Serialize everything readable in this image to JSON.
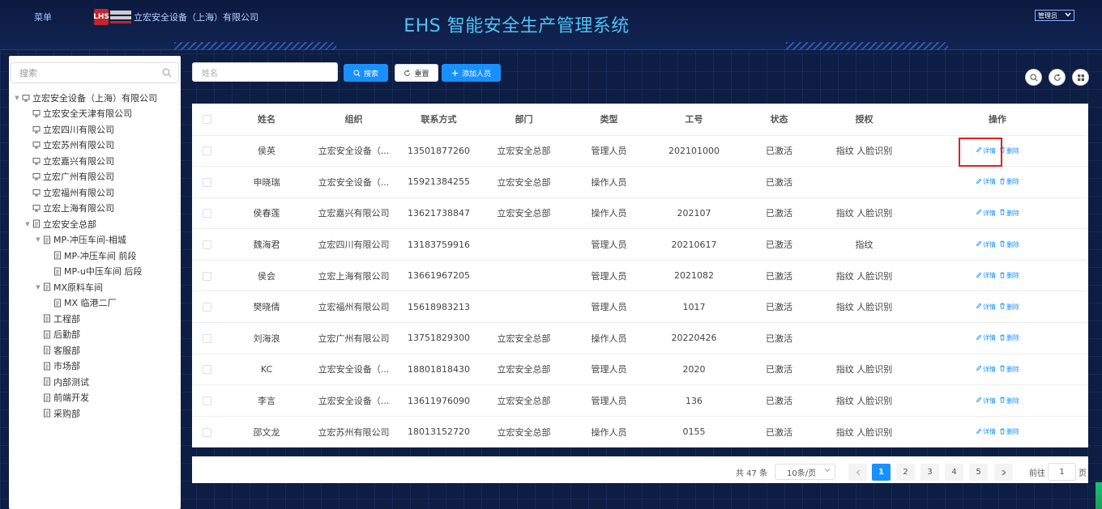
{
  "header": {
    "menu_label": "菜单",
    "logo_mark": "LHS",
    "company": "立宏安全设备（上海）有限公司",
    "title": "EHS 智能安全生产管理系统",
    "user_select": "管理员"
  },
  "sidebar": {
    "search_placeholder": "搜索",
    "nodes": [
      {
        "label": "立宏安全设备（上海）有限公司",
        "level": 0,
        "arrow": "▼",
        "icon": "monitor-icon"
      },
      {
        "label": "立宏安全天津有限公司",
        "level": 1,
        "arrow": "",
        "icon": "monitor-icon"
      },
      {
        "label": "立宏四川有限公司",
        "level": 1,
        "arrow": "",
        "icon": "monitor-icon"
      },
      {
        "label": "立宏苏州有限公司",
        "level": 1,
        "arrow": "",
        "icon": "monitor-icon"
      },
      {
        "label": "立宏嘉兴有限公司",
        "level": 1,
        "arrow": "",
        "icon": "monitor-icon"
      },
      {
        "label": "立宏广州有限公司",
        "level": 1,
        "arrow": "",
        "icon": "monitor-icon"
      },
      {
        "label": "立宏福州有限公司",
        "level": 1,
        "arrow": "",
        "icon": "monitor-icon"
      },
      {
        "label": "立宏上海有限公司",
        "level": 1,
        "arrow": "",
        "icon": "monitor-icon"
      },
      {
        "label": "立宏安全总部",
        "level": 1,
        "arrow": "▼",
        "icon": "document-icon"
      },
      {
        "label": "MP-冲压车间-相城",
        "level": 2,
        "arrow": "▼",
        "icon": "document-icon"
      },
      {
        "label": "MP-冲压车间 前段",
        "level": 3,
        "arrow": "",
        "icon": "document-icon"
      },
      {
        "label": "MP-u中压车间 后段",
        "level": 3,
        "arrow": "",
        "icon": "document-icon"
      },
      {
        "label": "MX原料车间",
        "level": 2,
        "arrow": "▼",
        "icon": "document-icon"
      },
      {
        "label": "MX 临港二厂",
        "level": 3,
        "arrow": "",
        "icon": "document-icon"
      },
      {
        "label": "工程部",
        "level": 2,
        "arrow": "",
        "icon": "document-icon"
      },
      {
        "label": "后勤部",
        "level": 2,
        "arrow": "",
        "icon": "document-icon"
      },
      {
        "label": "客服部",
        "level": 2,
        "arrow": "",
        "icon": "document-icon"
      },
      {
        "label": "市场部",
        "level": 2,
        "arrow": "",
        "icon": "document-icon"
      },
      {
        "label": "内部测试",
        "level": 2,
        "arrow": "",
        "icon": "document-icon"
      },
      {
        "label": "前端开发",
        "level": 2,
        "arrow": "",
        "icon": "document-icon"
      },
      {
        "label": "采购部",
        "level": 2,
        "arrow": "",
        "icon": "document-icon"
      }
    ]
  },
  "toolbar": {
    "name_placeholder": "姓名",
    "search_label": "搜索",
    "reset_label": "重置",
    "add_label": "添加人员"
  },
  "table": {
    "columns": [
      "姓名",
      "组织",
      "联系方式",
      "部门",
      "类型",
      "工号",
      "状态",
      "授权",
      "操作"
    ],
    "detail_label": "详情",
    "delete_label": "删除",
    "rows": [
      [
        "侯英",
        "立宏安全设备（...",
        "13501877260",
        "立宏安全总部",
        "管理人员",
        "202101000",
        "已激活",
        "指纹 人脸识别"
      ],
      [
        "申晓瑞",
        "立宏安全设备（...",
        "15921384255",
        "立宏安全总部",
        "操作人员",
        "",
        "已激活",
        ""
      ],
      [
        "侯春莲",
        "立宏嘉兴有限公司",
        "13621738847",
        "立宏安全总部",
        "操作人员",
        "202107",
        "已激活",
        "指纹 人脸识别"
      ],
      [
        "魏海君",
        "立宏四川有限公司",
        "13183759916",
        "",
        "管理人员",
        "20210617",
        "已激活",
        "指纹"
      ],
      [
        "侯会",
        "立宏上海有限公司",
        "13661967205",
        "",
        "管理人员",
        "2021082",
        "已激活",
        "指纹 人脸识别"
      ],
      [
        "樊晓倩",
        "立宏福州有限公司",
        "15618983213",
        "",
        "管理人员",
        "1017",
        "已激活",
        "指纹 人脸识别"
      ],
      [
        "刘海浪",
        "立宏广州有限公司",
        "13751829300",
        "立宏安全总部",
        "操作人员",
        "20220426",
        "已激活",
        ""
      ],
      [
        "KC",
        "立宏安全设备（...",
        "18801818430",
        "立宏安全总部",
        "管理人员",
        "2020",
        "已激活",
        "指纹 人脸识别"
      ],
      [
        "李言",
        "立宏安全设备（...",
        "13611976090",
        "立宏安全总部",
        "管理人员",
        "136",
        "已激活",
        "指纹 人脸识别"
      ],
      [
        "邵文龙",
        "立宏苏州有限公司",
        "18013152720",
        "立宏安全总部",
        "操作人员",
        "0155",
        "已激活",
        "指纹 人脸识别"
      ]
    ]
  },
  "pagination": {
    "total_text": "共 47 条",
    "page_size": "10条/页",
    "pages": [
      "1",
      "2",
      "3",
      "4",
      "5"
    ],
    "current": "1",
    "goto_label": "前往",
    "goto_value": "1",
    "suffix": "页"
  },
  "colors": {
    "primary": "#1890ff",
    "title": "#4fc3f7",
    "highlight": "#e02020"
  }
}
